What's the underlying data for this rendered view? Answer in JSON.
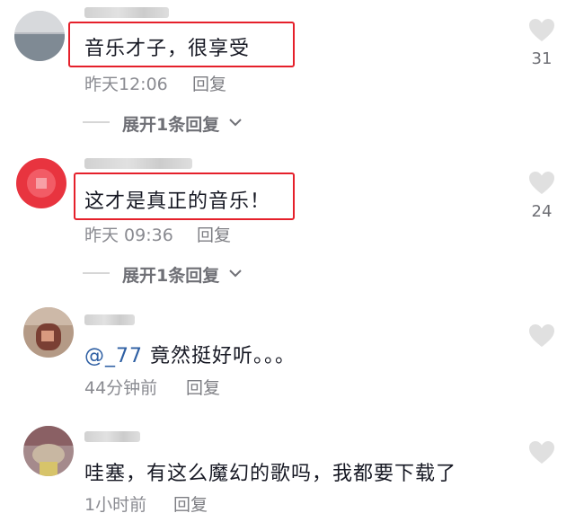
{
  "comments": [
    {
      "text": "音乐才子，很享受",
      "time": "昨天12:06",
      "reply": "回复",
      "expand": "展开1条回复",
      "likes": "31"
    },
    {
      "text": "这才是真正的音乐！",
      "time": "昨天 09:36",
      "reply": "回复",
      "expand": "展开1条回复",
      "likes": "24"
    },
    {
      "mention": "@_77",
      "text": " 竟然挺好听。。。",
      "time": "44分钟前",
      "reply": "回复"
    },
    {
      "text": "哇塞，有这么魔幻的歌吗，我都要下载了",
      "time": "1小时前",
      "reply": "回复"
    }
  ],
  "colors": {
    "highlight_box": "#e5202b",
    "mention": "#2e5fa3",
    "like_icon": "#e0e0e0"
  },
  "icons": {
    "like": "heart-icon",
    "expand": "chevron-down-icon"
  }
}
